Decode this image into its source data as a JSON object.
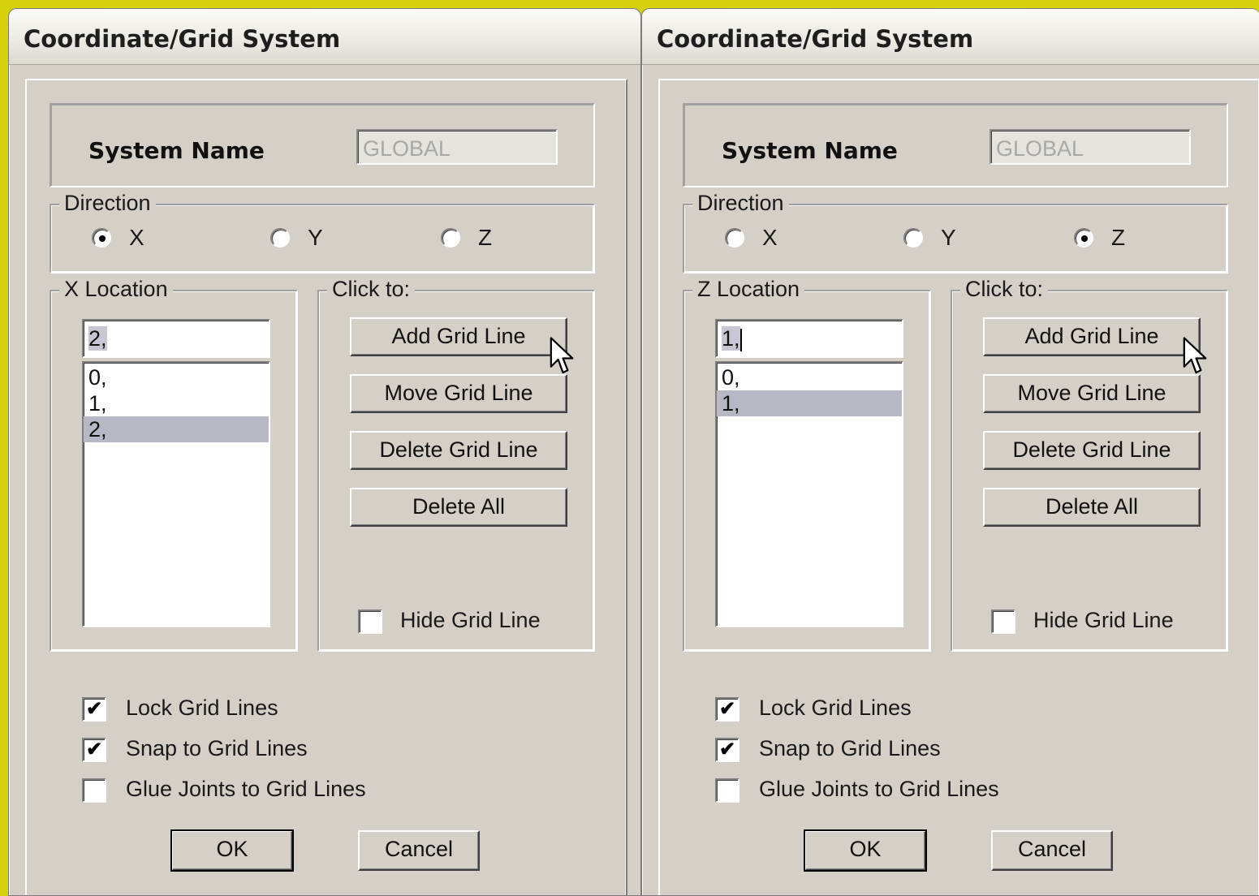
{
  "windows": [
    {
      "title": "Coordinate/Grid System",
      "system_name_label": "System Name",
      "system_name_value": "GLOBAL",
      "direction_legend": "Direction",
      "direction_options": [
        "X",
        "Y",
        "Z"
      ],
      "direction_selected": "X",
      "location_legend": "X Location",
      "location_input": "2,",
      "location_list": [
        "0,",
        "1,",
        "2,"
      ],
      "location_list_selected": "2,",
      "click_to_legend": "Click to:",
      "buttons": {
        "add": "Add Grid Line",
        "move": "Move Grid Line",
        "delete": "Delete Grid Line",
        "delete_all": "Delete All"
      },
      "hide_grid_line": {
        "label": "Hide Grid Line",
        "checked": false
      },
      "checkboxes": [
        {
          "label": "Lock Grid Lines",
          "checked": true
        },
        {
          "label": "Snap to Grid Lines",
          "checked": true
        },
        {
          "label": "Glue Joints to Grid Lines",
          "checked": false
        }
      ],
      "ok_label": "OK",
      "cancel_label": "Cancel"
    },
    {
      "title": "Coordinate/Grid System",
      "system_name_label": "System Name",
      "system_name_value": "GLOBAL",
      "direction_legend": "Direction",
      "direction_options": [
        "X",
        "Y",
        "Z"
      ],
      "direction_selected": "Z",
      "location_legend": "Z Location",
      "location_input": "1,",
      "location_list": [
        "0,",
        "1,"
      ],
      "location_list_selected": "1,",
      "click_to_legend": "Click to:",
      "buttons": {
        "add": "Add Grid Line",
        "move": "Move Grid Line",
        "delete": "Delete Grid Line",
        "delete_all": "Delete All"
      },
      "hide_grid_line": {
        "label": "Hide Grid Line",
        "checked": false
      },
      "checkboxes": [
        {
          "label": "Lock Grid Lines",
          "checked": true
        },
        {
          "label": "Snap to Grid Lines",
          "checked": true
        },
        {
          "label": "Glue Joints to Grid Lines",
          "checked": false
        }
      ],
      "ok_label": "OK",
      "cancel_label": "Cancel"
    }
  ],
  "colors": {
    "background": "#d6d10a",
    "dialog_face": "#d4d0c8",
    "list_selection": "#b8b8c4"
  },
  "icons": {
    "cursor": "mouse-pointer-icon",
    "check": "checkmark-icon"
  }
}
